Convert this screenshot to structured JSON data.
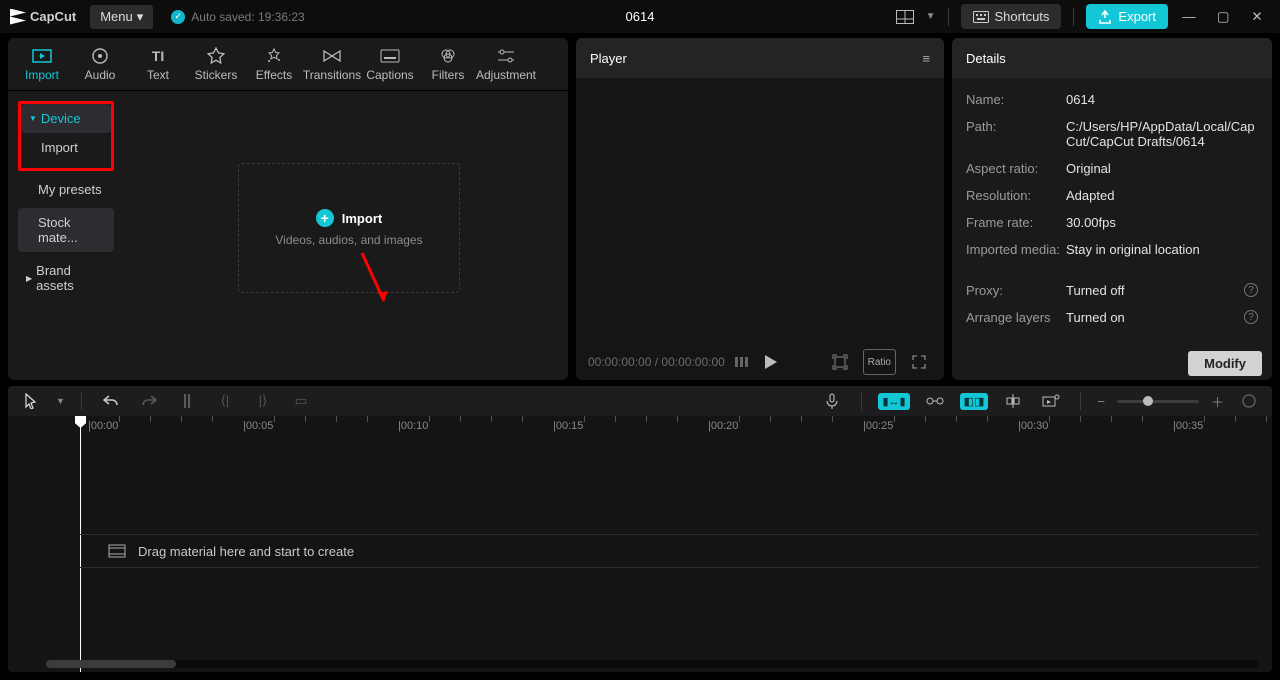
{
  "app": {
    "name": "CapCut"
  },
  "titlebar": {
    "menu_label": "Menu",
    "autosave_label": "Auto saved: 19:36:23",
    "project_title": "0614",
    "shortcuts_label": "Shortcuts",
    "export_label": "Export"
  },
  "media_tabs": [
    {
      "id": "import",
      "label": "Import"
    },
    {
      "id": "audio",
      "label": "Audio"
    },
    {
      "id": "text",
      "label": "Text"
    },
    {
      "id": "stickers",
      "label": "Stickers"
    },
    {
      "id": "effects",
      "label": "Effects"
    },
    {
      "id": "transitions",
      "label": "Transitions"
    },
    {
      "id": "captions",
      "label": "Captions"
    },
    {
      "id": "filters",
      "label": "Filters"
    },
    {
      "id": "adjustment",
      "label": "Adjustment"
    }
  ],
  "side_tree": {
    "device": "Device",
    "import": "Import",
    "presets": "My presets",
    "stock": "Stock mate...",
    "brand": "Brand assets"
  },
  "import_card": {
    "title": "Import",
    "subtitle": "Videos, audios, and images"
  },
  "player": {
    "title": "Player",
    "time_current": "00:00:00:00",
    "time_total": "00:00:00:00",
    "ratio_label": "Ratio"
  },
  "details": {
    "title": "Details",
    "rows": {
      "name_k": "Name:",
      "name_v": "0614",
      "path_k": "Path:",
      "path_v": "C:/Users/HP/AppData/Local/CapCut/CapCut Drafts/0614",
      "aspect_k": "Aspect ratio:",
      "aspect_v": "Original",
      "res_k": "Resolution:",
      "res_v": "Adapted",
      "fps_k": "Frame rate:",
      "fps_v": "30.00fps",
      "imp_k": "Imported media:",
      "imp_v": "Stay in original location",
      "proxy_k": "Proxy:",
      "proxy_v": "Turned off",
      "layers_k": "Arrange layers",
      "layers_v": "Turned on"
    },
    "modify_label": "Modify"
  },
  "timeline": {
    "marks": [
      "00:00",
      "00:05",
      "00:10",
      "00:15",
      "00:20",
      "00:25",
      "00:30",
      "00:35"
    ],
    "hint": "Drag material here and start to create"
  }
}
